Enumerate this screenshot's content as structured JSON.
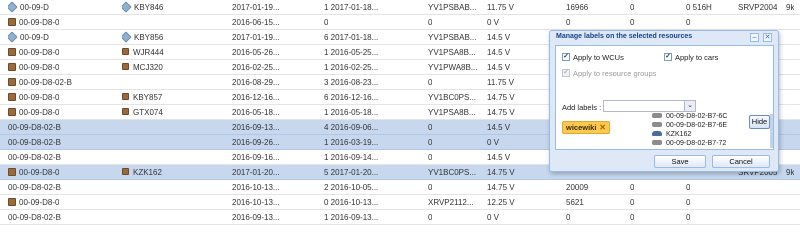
{
  "grid": {
    "rows": [
      {
        "icon": "tag",
        "c1": "00-09-D",
        "c2": "KBY846",
        "c3": "2017-01-19...",
        "c4": "1 2017-01-18...",
        "c5": "YV1PSBAB...",
        "c6": "11.75 V",
        "c7": "16966",
        "c8": "0",
        "c9": "0 516H",
        "c10": "SRVP2004",
        "c11": "9k"
      },
      {
        "icon": "box",
        "c1": "00-09-D8-0",
        "c2": "",
        "c3": "2016-06-15...",
        "c4": "0",
        "c5": "0",
        "c6": "0 V",
        "c7": "0",
        "c8": "0",
        "c9": "0",
        "c10": "",
        "c11": ""
      },
      {
        "icon": "tag",
        "c1": "00-09-D",
        "c2": "KBY856",
        "c3": "2017-01-19...",
        "c4": "6 2017-01-18...",
        "c5": "YV1PSBAB...",
        "c6": "14.5 V",
        "c7": "",
        "c8": "",
        "c9": "",
        "c10": "",
        "c11": ""
      },
      {
        "icon": "box",
        "c1": "00-09-D8-0",
        "c2": "WJR444",
        "c3": "2016-05-26...",
        "c4": "1 2016-05-25...",
        "c5": "YV1PSA8B...",
        "c6": "14.5 V",
        "c7": "",
        "c8": "",
        "c9": "",
        "c10": "",
        "c11": ""
      },
      {
        "icon": "box",
        "c1": "00-09-D8-0",
        "c2": "MCJ320",
        "c3": "2016-02-25...",
        "c4": "1 2016-02-25...",
        "c5": "YV1PWA8B...",
        "c6": "14.5 V",
        "c7": "",
        "c8": "",
        "c9": "",
        "c10": "",
        "c11": ""
      },
      {
        "icon": "box",
        "c1": "00-09-D8-02-B",
        "c2": "",
        "c3": "2016-08-29...",
        "c4": "3 2016-08-23...",
        "c5": "0",
        "c6": "11.75 V",
        "c7": "",
        "c8": "",
        "c9": "",
        "c10": "",
        "c11": ""
      },
      {
        "icon": "box",
        "c1": "00-09-D8-0",
        "c2": "KBY857",
        "c3": "2016-12-16...",
        "c4": "6 2016-12-16...",
        "c5": "YV1BC0PS...",
        "c6": "14.75 V",
        "c7": "",
        "c8": "",
        "c9": "",
        "c10": "",
        "c11": ""
      },
      {
        "icon": "box",
        "c1": "00-09-D8-0",
        "c2": "GTX074",
        "c3": "2016-05-18...",
        "c4": "1 2016-05-18...",
        "c5": "YV1PSA8B...",
        "c6": "14.75 V",
        "c7": "",
        "c8": "",
        "c9": "",
        "c10": "",
        "c11": ""
      },
      {
        "icon": "none",
        "sel": true,
        "c1": "00-09-D8-02-B",
        "c2": "",
        "c3": "2016-09-13...",
        "c4": "4 2016-09-06...",
        "c5": "0",
        "c6": "14.5 V",
        "c7": "",
        "c8": "",
        "c9": "",
        "c10": "",
        "c11": ""
      },
      {
        "icon": "none",
        "sel": true,
        "c1": "00-09-D8-02-B",
        "c2": "",
        "c3": "2016-09-26...",
        "c4": "1 2016-03-19...",
        "c5": "0",
        "c6": "0 V",
        "c7": "",
        "c8": "",
        "c9": "",
        "c10": "",
        "c11": ""
      },
      {
        "icon": "none",
        "c1": "00-09-D8-02-B",
        "c2": "",
        "c3": "2016-09-16...",
        "c4": "1 2016-09-14...",
        "c5": "0",
        "c6": "14.5 V",
        "c7": "",
        "c8": "",
        "c9": "",
        "c10": "",
        "c11": ""
      },
      {
        "icon": "box",
        "sel": true,
        "c1": "00-09-D8-0",
        "c2": "KZK162",
        "c3": "2017-01-20...",
        "c4": "5 2017-01-20...",
        "c5": "YV1BC0PS...",
        "c6": "14.75 V",
        "c7": "",
        "c8": "",
        "c9": "",
        "c10": "SRVP2005",
        "c11": "9k"
      },
      {
        "icon": "none",
        "c1": "00-09-D8-02-B",
        "c2": "",
        "c3": "2016-10-13...",
        "c4": "2 2016-10-05...",
        "c5": "0",
        "c6": "14.75 V",
        "c7": "20009",
        "c8": "0",
        "c9": "0",
        "c10": "",
        "c11": ""
      },
      {
        "icon": "box",
        "c1": "00-09-D8-0",
        "c2": "",
        "c3": "2016-10-13...",
        "c4": "0 2016-10-13...",
        "c5": "XRVP2112...",
        "c6": "12.25 V",
        "c7": "5621",
        "c8": "0",
        "c9": "0",
        "c10": "",
        "c11": ""
      },
      {
        "icon": "none",
        "c1": "00-09-D8-02-B",
        "c2": "",
        "c3": "2016-09-13...",
        "c4": "1 2016-09-13...",
        "c5": "0",
        "c6": "0 V",
        "c7": "0",
        "c8": "0",
        "c9": "0",
        "c10": "",
        "c11": ""
      }
    ]
  },
  "dialog": {
    "title": "Manage labels on the selected resources",
    "apply_wcus": "Apply to WCUs",
    "apply_cars": "Apply to cars",
    "apply_groups": "Apply to resource groups",
    "add_labels": "Add labels :",
    "combo_value": "",
    "combo_trigger": "⌄",
    "label_chip": "wicewiki",
    "chip_remove": "✕",
    "hide_button": "Hide",
    "resources": [
      {
        "name": "00-09-D8-02-B7-6C",
        "type": "wcu"
      },
      {
        "name": "00-09-D8-02-B7-6E",
        "type": "wcu"
      },
      {
        "name": "KZK162",
        "type": "car"
      },
      {
        "name": "00-09-D8-02-B7-72",
        "type": "wcu"
      }
    ],
    "save_button": "Save",
    "cancel_button": "Cancel",
    "tool_minimize": "–",
    "tool_close": "✕"
  }
}
